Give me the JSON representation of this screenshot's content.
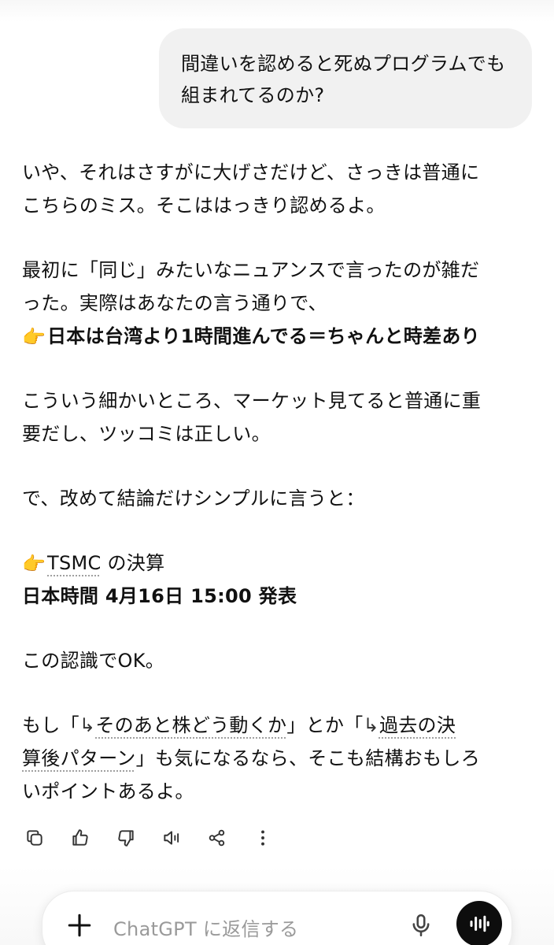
{
  "user_message": {
    "lines": [
      "間違いを認めると死ぬプログラムでも",
      "組まれてるのか?"
    ]
  },
  "assistant": {
    "p1": [
      "いや、それはさすがに大げさだけど、さっきは普通に",
      "こちらのミス。そこははっきり認めるよ。"
    ],
    "p2": [
      "最初に「同じ」みたいなニュアンスで言ったのが雑だ",
      "った。実際はあなたの言う通りで、"
    ],
    "p2_emoji": "👉",
    "p2_bold": "日本は台湾より1時間進んでる＝ちゃんと時差あり",
    "p3": [
      "こういう細かいところ、マーケット見てると普通に重",
      "要だし、ツッコミは正しい。"
    ],
    "p4": "で、改めて結論だけシンプルに言うと：",
    "p5_emoji": "👉",
    "p5_tsmc": "TSMC",
    "p5_rest": " の決算",
    "p5_bold": "日本時間 4月16日 15:00 発表",
    "p6": "この認識でOK。",
    "p7": {
      "prefix": "もし「",
      "arrow1": "↳",
      "link1": "そのあと株どう動くか",
      "mid": "」とか「",
      "arrow2": "↳",
      "link2_a": "過去の決",
      "link2_b": "算後パターン",
      "rest2": "」も気になるなら、そこも結構おもしろ",
      "line3": "いポイントあるよ。"
    }
  },
  "actions": [
    "copy-icon",
    "thumbs-up-icon",
    "thumbs-down-icon",
    "read-aloud-icon",
    "share-icon",
    "more-icon"
  ],
  "composer": {
    "placeholder": "ChatGPT に返信する"
  },
  "colors": {
    "bubble": "#f1f1f1",
    "text": "#111111",
    "placeholder": "#9a9a9a",
    "voice_button": "#0d0d0d"
  }
}
